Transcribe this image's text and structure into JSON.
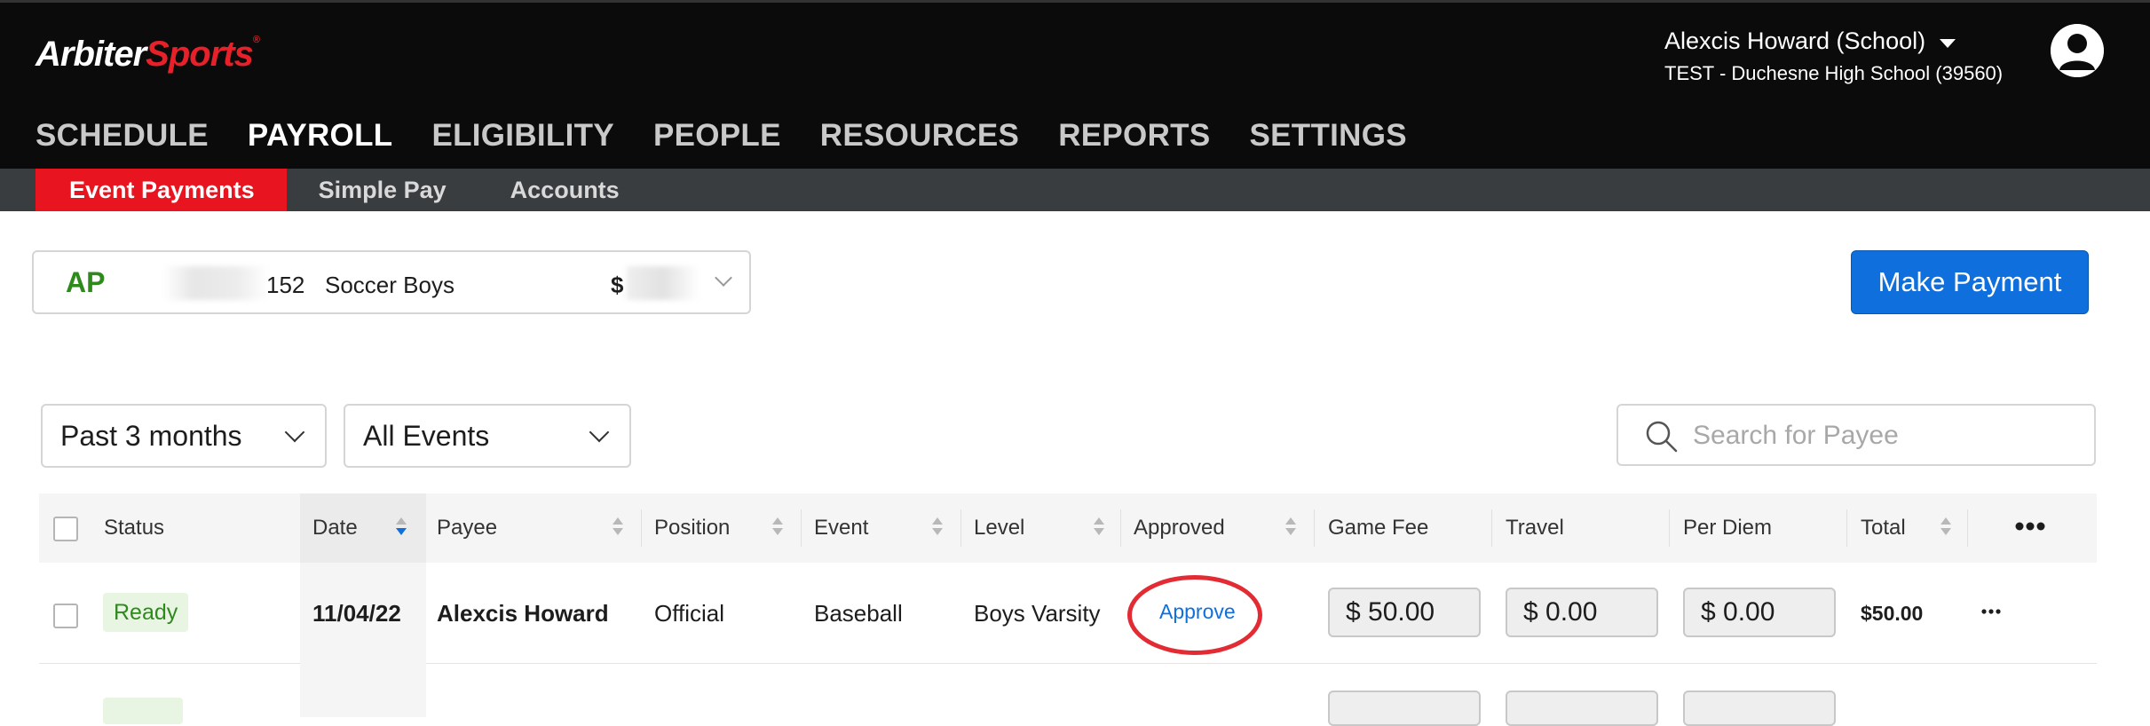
{
  "header": {
    "logo_part1": "Arbiter",
    "logo_part2": "Sports",
    "logo_tm": "®",
    "user_name": "Alexcis Howard (School)",
    "school": "TEST - Duchesne High School (39560)"
  },
  "main_nav": [
    "SCHEDULE",
    "PAYROLL",
    "ELIGIBILITY",
    "PEOPLE",
    "RESOURCES",
    "REPORTS",
    "SETTINGS"
  ],
  "main_nav_active": "PAYROLL",
  "sub_nav": [
    "Event Payments",
    "Simple Pay",
    "Accounts"
  ],
  "sub_nav_active": "Event Payments",
  "account": {
    "prefix": "AP",
    "number_suffix": "152",
    "name": "Soccer Boys",
    "currency": "$"
  },
  "make_payment_label": "Make Payment",
  "filters": {
    "date_range": "Past 3 months",
    "event_filter": "All Events",
    "search_placeholder": "Search for Payee"
  },
  "table": {
    "columns": [
      "Status",
      "Date",
      "Payee",
      "Position",
      "Event",
      "Level",
      "Approved",
      "Game Fee",
      "Travel",
      "Per Diem",
      "Total"
    ],
    "rows": [
      {
        "status": "Ready",
        "date": "11/04/22",
        "payee": "Alexcis Howard",
        "position": "Official",
        "event": "Baseball",
        "level": "Boys Varsity",
        "approved_action": "Approve",
        "game_fee": "$ 50.00",
        "travel": "$ 0.00",
        "per_diem": "$ 0.00",
        "total": "$50.00"
      }
    ]
  },
  "colors": {
    "brand_red": "#e8141f",
    "primary_blue": "#0f6fdc",
    "status_green": "#2f8a1e",
    "annotation_red": "#e22b33"
  }
}
